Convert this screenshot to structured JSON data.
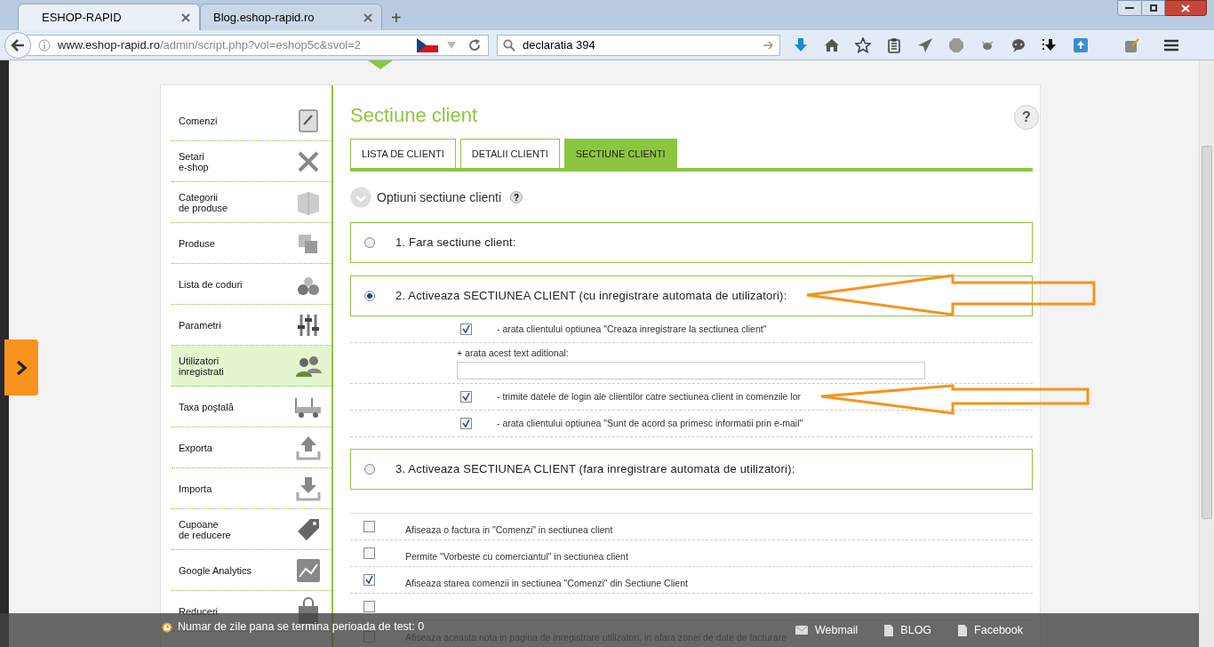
{
  "browser": {
    "tabs": [
      {
        "label": "ESHOP-RAPID",
        "selected": true
      },
      {
        "label": "Blog.eshop-rapid.ro",
        "selected": false
      }
    ],
    "new_tab": "+",
    "url_host": "www.eshop-rapid.ro",
    "url_path": "/admin/script.php?vol=eshop5c&svol=2",
    "search": "declaratia 394"
  },
  "sidebar": {
    "items": [
      {
        "label": "Comenzi",
        "selected": false
      },
      {
        "label": "Setari\ne-shop",
        "selected": false
      },
      {
        "label": "Categorii\nde produse",
        "selected": false
      },
      {
        "label": "Produse",
        "selected": false
      },
      {
        "label": "Lista de coduri",
        "selected": false
      },
      {
        "label": "Parametri",
        "selected": false
      },
      {
        "label": "Utilizatori\ninregistrati",
        "selected": true
      },
      {
        "label": "Taxa poştală",
        "selected": false
      },
      {
        "label": "Exporta",
        "selected": false
      },
      {
        "label": "Importa",
        "selected": false
      },
      {
        "label": "Cupoane\nde reducere",
        "selected": false
      },
      {
        "label": "Google Analytics",
        "selected": false
      },
      {
        "label": "Reduceri",
        "selected": false
      }
    ]
  },
  "page": {
    "title": "Sectiune client",
    "help": "?",
    "tabs": [
      {
        "label": "LISTA DE CLIENTI",
        "selected": false
      },
      {
        "label": "DETALII CLIENTI",
        "selected": false
      },
      {
        "label": "SECTIUNE CLIENTI",
        "selected": true
      }
    ],
    "section_title": "Optiuni sectiune clienti",
    "section_help": "?",
    "options": [
      {
        "label": "1. Fara sectiune client:",
        "selected": false
      },
      {
        "label": "2. Activeaza SECTIUNEA CLIENT (cu inregistrare automata de utilizatori):",
        "selected": true,
        "sub_options": [
          {
            "kind": "checkbox",
            "label": "- arata clientului optiunea \"Creaza inregistrare la sectiunea client\"",
            "checked": true
          },
          {
            "kind": "text_field",
            "label": "+ arata acest text aditional:"
          },
          {
            "kind": "checkbox",
            "label": "- trimite datele de login ale clientilor catre sectiunea client in comenzile lor",
            "checked": true
          },
          {
            "kind": "checkbox",
            "label": "- arata clientului optiunea \"Sunt de acord sa primesc informatii prin e-mail\"",
            "checked": true
          }
        ]
      },
      {
        "label": "3. Activeaza SECTIUNEA CLIENT (fara inregistrare automata de utilizatori):",
        "selected": false
      }
    ],
    "settings": [
      {
        "label": "Afiseaza o factura in \"Comenzi\" in sectiunea client",
        "checked": false
      },
      {
        "label": "Permite \"Vorbeste cu comerciantul\" in sectiunea client",
        "checked": false
      },
      {
        "label": "Afiseaza starea comenzii in sectiunea \"Comenzi\" din Sectiune Client",
        "checked": true
      },
      {
        "checked": false
      },
      {
        "label": "Afiseaza aceasta nota in pagina de inregistrare utilizatori, in afara zonei de date de facturare",
        "checked": false
      }
    ]
  },
  "footer": {
    "notice": "Numar de zile pana se termina perioada de test: 0",
    "links": [
      {
        "kind": "mail",
        "label": "Webmail"
      },
      {
        "kind": "page",
        "label": "BLOG"
      },
      {
        "kind": "page",
        "label": "Facebook"
      }
    ]
  }
}
